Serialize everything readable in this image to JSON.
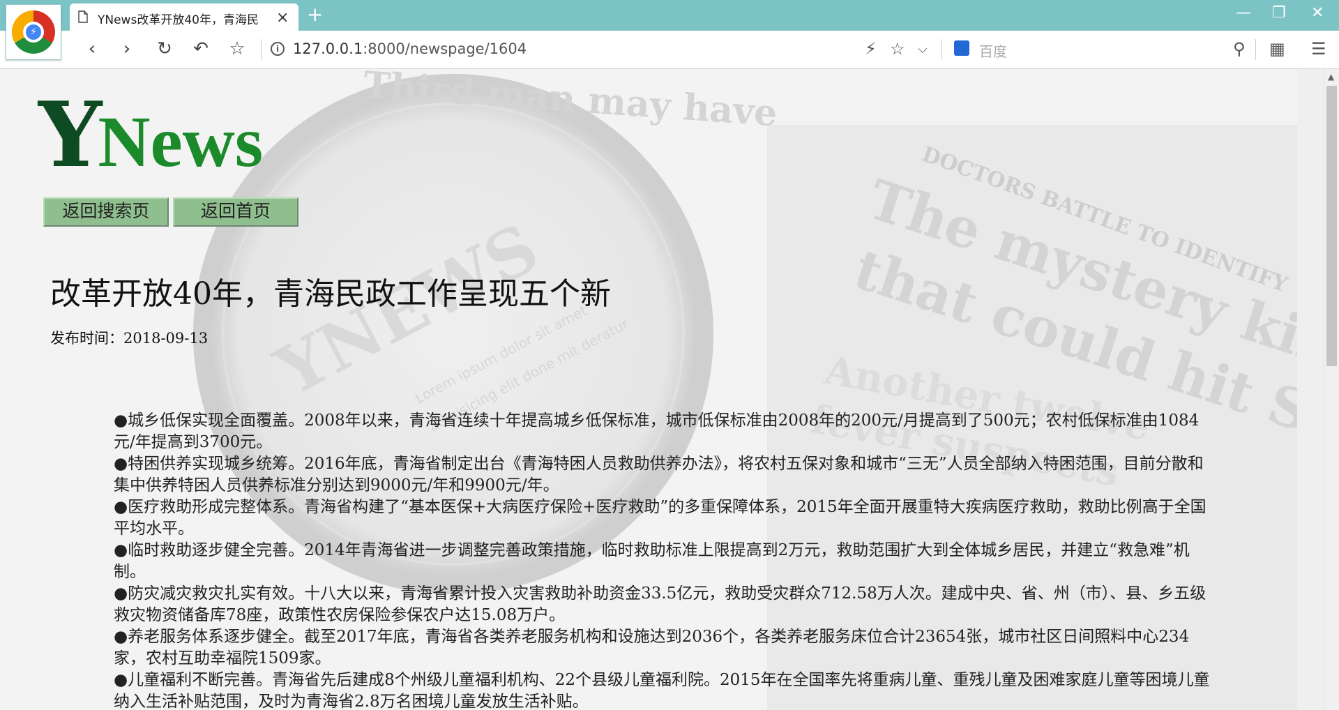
{
  "browser": {
    "tab_title": "YNews改革开放40年，青海民",
    "url_host": "127.0.0.1",
    "url_rest": ":8000/newspage/1604",
    "search_engine_label": "百度",
    "new_tab_glyph": "+",
    "close_glyph": "×"
  },
  "site": {
    "logo_y": "Y",
    "logo_news": "News",
    "buttons": {
      "back_to_search": "返回搜索页",
      "back_to_home": "返回首页"
    }
  },
  "article": {
    "title": "改革开放40年，青海民政工作呈现五个新",
    "publish_label": "发布时间：",
    "publish_date": "2018-09-13",
    "paragraphs": [
      "●城乡低保实现全面覆盖。2008年以来，青海省连续十年提高城乡低保标准，城市低保标准由2008年的200元/月提高到了500元；农村低保标准由1084元/年提高到3700元。",
      "●特困供养实现城乡统筹。2016年底，青海省制定出台《青海特困人员救助供养办法》，将农村五保对象和城市“三无”人员全部纳入特困范围，目前分散和集中供养特困人员供养标准分别达到9000元/年和9900元/年。",
      "●医疗救助形成完整体系。青海省构建了“基本医保+大病医疗保险+医疗救助”的多重保障体系，2015年全面开展重特大疾病医疗救助，救助比例高于全国平均水平。",
      "●临时救助逐步健全完善。2014年青海省进一步调整完善政策措施，临时救助标准上限提高到2万元，救助范围扩大到全体城乡居民，并建立“救急难”机制。",
      "●防灾减灾救灾扎实有效。十八大以来，青海省累计投入灾害救助补助资金33.5亿元，救助受灾群众712.58万人次。建成中央、省、州（市）、县、乡五级救灾物资储备库78座，政策性农房保险参保农户达15.08万户。",
      "●养老服务体系逐步健全。截至2017年底，青海省各类养老服务机构和设施达到2036个，各类养老服务床位合计23654张，城市社区日间照料中心234家，农村互助幸福院1509家。",
      "●儿童福利不断完善。青海省先后建成8个州级儿童福利机构、22个县级儿童福利院。2015年在全国率先将重病儿童、重残儿童及困难家庭儿童等困境儿童纳入生活补贴范围，及时为青海省2.8万名困境儿童发放生活补贴。"
    ]
  },
  "background_text": {
    "top": "Third man may have",
    "right_band": "DOCTORS BATTLE TO IDENTIFY",
    "right_1": "The mystery killer",
    "right_2": "that could hit SA",
    "right_3": "Another twelve",
    "right_4": "fever suspects",
    "center": "YNEWS",
    "lorem_1": "Lorem ipsum dolor sit amet",
    "lorem_2": "adipisicing elit done mit deratur"
  },
  "colors": {
    "tabbar": "#7cc3c6",
    "logo_y": "#0e4a22",
    "logo_news": "#1b8a2a",
    "button_bg": "#8fbf8f"
  }
}
